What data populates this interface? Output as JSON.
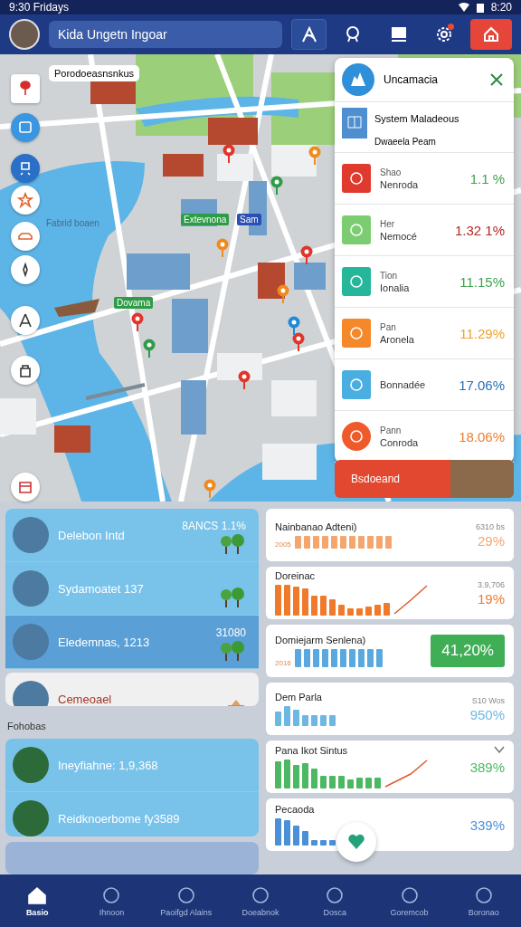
{
  "status_bar": {
    "time": "9:30 Fridays",
    "clock": "8:20"
  },
  "app_bar": {
    "title": "Kida Ungetn Ingoar",
    "actions": [
      {
        "kind": "route",
        "selected": true
      },
      {
        "kind": "search",
        "selected": false
      },
      {
        "kind": "monitor",
        "selected": false
      },
      {
        "kind": "settings",
        "selected": false,
        "notification": true
      },
      {
        "kind": "home",
        "selected": false
      }
    ]
  },
  "map": {
    "search_label": "Porodoeasnsnkus",
    "controls": [
      {
        "kind": "pin",
        "selected": false
      },
      {
        "kind": "bus",
        "selected": false
      },
      {
        "kind": "transit",
        "selected": true
      },
      {
        "kind": "star",
        "selected": false
      },
      {
        "kind": "car",
        "selected": false
      },
      {
        "kind": "compass",
        "selected": false
      },
      {
        "kind": "hiker",
        "selected": false
      },
      {
        "kind": "bag",
        "selected": false
      },
      {
        "kind": "calendar",
        "selected": false
      }
    ],
    "labels": [
      {
        "text": "Fabrid boaen",
        "kind": "plain"
      },
      {
        "text": "Extevnona",
        "kind": "tag",
        "color": "#2e9b46"
      },
      {
        "text": "Sam",
        "kind": "tag",
        "color": "#2a4fb5"
      },
      {
        "text": "Dovama",
        "kind": "tag",
        "color": "#2e9b46"
      }
    ],
    "pins": [
      {
        "color": "#e0352b"
      },
      {
        "color": "#f08a1c"
      },
      {
        "color": "#2e9b46"
      },
      {
        "color": "#f08a1c"
      },
      {
        "color": "#e0352b"
      },
      {
        "color": "#f08a1c"
      },
      {
        "color": "#e0352b"
      },
      {
        "color": "#2e9b46"
      },
      {
        "color": "#e0352b"
      },
      {
        "color": "#1f88d8"
      },
      {
        "color": "#e0352b"
      },
      {
        "color": "#f08a1c"
      }
    ]
  },
  "panel": {
    "title": "Uncamacia",
    "summary": {
      "title": "System Maladeous",
      "subtitle": "Dwaeela Peam"
    },
    "rows": [
      {
        "label": "Shao",
        "name": "Nenroda",
        "value": {
          "text": "1.1 %",
          "color": "#3fa34d"
        },
        "color": "#e0392e"
      },
      {
        "label": "Her",
        "name": "Nemocé",
        "value": {
          "text": "1.32 1%",
          "color": "#b3261e"
        },
        "color": "#7ccd72"
      },
      {
        "label": "Tion",
        "name": "Ionalia",
        "value": {
          "text": "11.15%",
          "color": "#3fa34d"
        },
        "color": "#26b79b"
      },
      {
        "label": "Pan",
        "name": "Aronela",
        "value": {
          "text": "11.29%",
          "color": "#f0a030"
        },
        "color": "#f5892a"
      },
      {
        "name": "Bonnadée",
        "value": {
          "text": "17.06%",
          "color": "#2a6fb8"
        },
        "color": "#4aaee0"
      },
      {
        "label": "Pann",
        "name": "Conroda",
        "value": {
          "text": "18.06%",
          "color": "#ee7d2b"
        },
        "color": "#ef5a2a"
      }
    ],
    "banner": "Bsdoeand"
  },
  "places": [
    {
      "title": "Delebon Intd",
      "meta": "8ANCS 1.1%",
      "kind": "info",
      "selected": false
    },
    {
      "title": "Sydamoatet 137",
      "kind": "info",
      "selected": false
    },
    {
      "title": "Eledemnas, 1213",
      "meta": "31080",
      "kind": "info",
      "selected": true
    },
    {
      "title": "Cemeoael",
      "kind": "notice",
      "selected": false
    }
  ],
  "section": "Fohobas",
  "places_2": [
    {
      "title": "Ineyfiahne: 1,9,368",
      "selected": false
    },
    {
      "title": "Reidknoerbome fy3589",
      "selected": false
    }
  ],
  "stats": [
    {
      "title": "Nainbanao Adteni)",
      "caption": "2005",
      "note": "6310 bs",
      "value": "29%",
      "color": "#f4a66e",
      "kind": "bars"
    },
    {
      "title": "Doreinac",
      "note": "3.9,706",
      "value": "19%",
      "color": "#f07a2c",
      "kind": "trend"
    },
    {
      "title": "Domiejarm Senlena)",
      "caption": "2016",
      "value": "41,20%",
      "color": "#5aa8e0",
      "kind": "badge"
    },
    {
      "title": "Dem Parla",
      "note": "S10 Wos",
      "value": "950%",
      "color": "#6cb8e2",
      "kind": "bars"
    },
    {
      "title": "Pana Ikot Sintus",
      "value": "389%",
      "color": "#4cb863",
      "kind": "trend",
      "expanded": false
    },
    {
      "title": "Pecaoda",
      "value": "339%",
      "color": "#4a90d9",
      "kind": "bars"
    }
  ],
  "nav": [
    {
      "label": "Basio",
      "selected": true
    },
    {
      "label": "Ihnoon",
      "selected": false
    },
    {
      "label": "Paoifgd Alains",
      "selected": false
    },
    {
      "label": "Doeabnok",
      "selected": false
    },
    {
      "label": "Dosca",
      "selected": false
    },
    {
      "label": "Goremcob",
      "selected": false
    },
    {
      "label": "Boronao",
      "selected": false
    }
  ]
}
